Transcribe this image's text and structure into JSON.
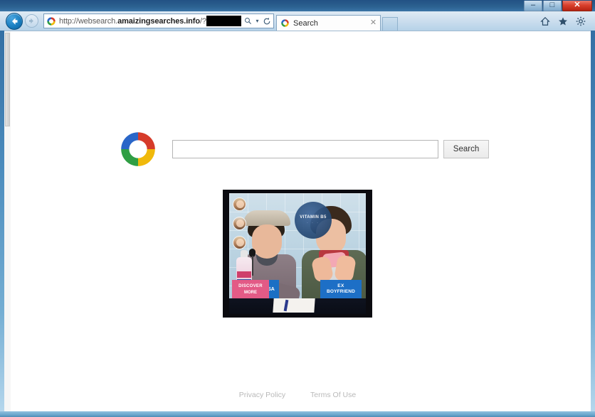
{
  "window": {
    "minimize_label": "–",
    "maximize_label": "□",
    "close_label": "✕"
  },
  "browser": {
    "back_title": "Back",
    "forward_title": "Forward",
    "address": {
      "scheme_host_prefix": "http://websearch.",
      "domain": "amaizingsearches.info",
      "path_suffix": "/?",
      "redacted": true,
      "search_icon": "magnifier-icon",
      "dropdown_icon": "chevron-down-icon",
      "refresh_icon": "refresh-icon"
    },
    "tab": {
      "title": "Search",
      "close_label": "✕",
      "favicon": "colored-ring-favicon"
    },
    "new_tab_label": "",
    "commands": [
      {
        "name": "home-icon",
        "glyph": "⌂"
      },
      {
        "name": "favorites-icon",
        "glyph": "★"
      },
      {
        "name": "settings-gear-icon",
        "glyph": "⚙"
      }
    ]
  },
  "page": {
    "logo": {
      "name": "colored-ring-logo",
      "colors": {
        "blue": "#2a66c8",
        "red": "#d63b2a",
        "yellow": "#f0b90b",
        "green": "#2f9e44"
      }
    },
    "search": {
      "input_value": "",
      "input_placeholder": "",
      "button_label": "Search"
    },
    "ad": {
      "name": "video-ad-thumbnail",
      "vitamin_badge": {
        "label": "VITAMIN B5",
        "sub": "· · ·"
      },
      "signs": {
        "discover_line1": "DISCOVER",
        "discover_line2": "MORE",
        "sa_label": "SA",
        "ex_line1": "EX",
        "ex_line2": "BOYFRIEND"
      }
    },
    "footer": {
      "privacy_label": "Privacy Policy",
      "terms_label": "Terms Of Use"
    }
  }
}
